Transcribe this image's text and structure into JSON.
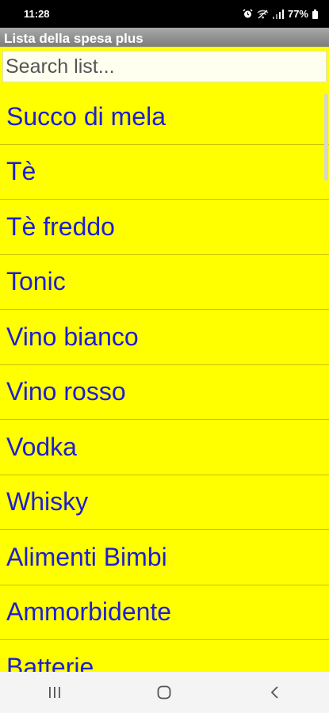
{
  "status_bar": {
    "time": "11:28",
    "battery": "77%",
    "icons": [
      "alarm-icon",
      "wifi-icon",
      "signal-icon",
      "battery-icon"
    ]
  },
  "app": {
    "title": "Lista della spesa plus"
  },
  "search": {
    "placeholder": "Search list..."
  },
  "list": {
    "items": [
      "Succo di mela",
      "Tè",
      "Tè freddo",
      "Tonic",
      "Vino bianco",
      "Vino rosso",
      "Vodka",
      "Whisky",
      "Alimenti Bimbi",
      "Ammorbidente",
      "Batterie"
    ]
  },
  "nav_bar": {
    "icons": [
      "recent-apps-icon",
      "home-icon",
      "back-icon"
    ]
  },
  "colors": {
    "background": "#ffff00",
    "item_text": "#1e1ed2"
  }
}
